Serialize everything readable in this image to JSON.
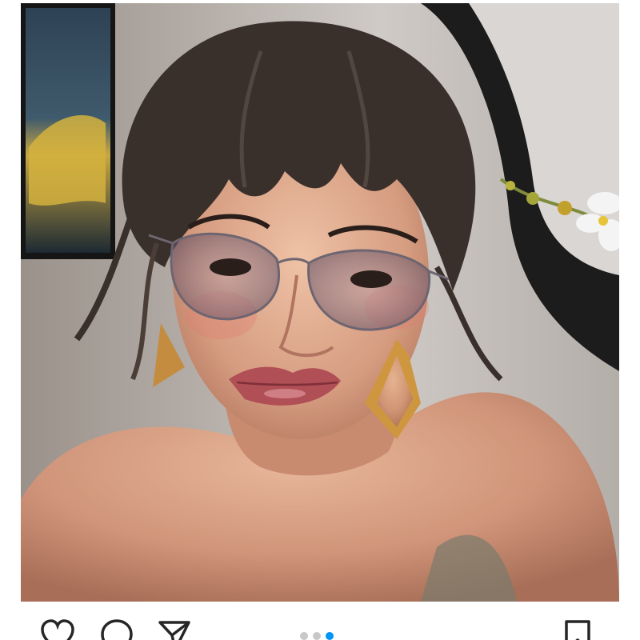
{
  "post": {
    "image_subject": "portrait-photo",
    "carousel": {
      "total": 3,
      "active_index": 2,
      "active_color": "#0095f6",
      "inactive_color": "#c8c8c8"
    }
  },
  "actions": {
    "like_icon": "heart-icon",
    "comment_icon": "speech-bubble-icon",
    "share_icon": "paper-plane-icon",
    "save_icon": "bookmark-icon",
    "icon_color": "#262626"
  }
}
